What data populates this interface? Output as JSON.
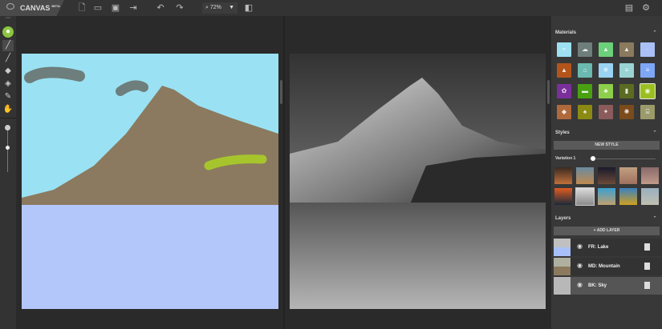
{
  "header": {
    "app_name": "CANVAS",
    "badge": "BETA",
    "logo_text": "NVIDIA",
    "zoom": "72%"
  },
  "materials": {
    "title": "Materials",
    "swatches": [
      {
        "color": "#9ee0f2",
        "icon": "≈"
      },
      {
        "color": "#6e7e7b",
        "icon": "☁"
      },
      {
        "color": "#6ccf7a",
        "icon": "▲"
      },
      {
        "color": "#8b7a5e",
        "icon": "▲"
      },
      {
        "color": "#a9c1f7",
        "icon": "·"
      },
      {
        "color": "#b3551b",
        "icon": "▲"
      },
      {
        "color": "#6bb9b1",
        "icon": "⌂"
      },
      {
        "color": "#99d2f2",
        "icon": "❄"
      },
      {
        "color": "#9ad3d3",
        "icon": "≡"
      },
      {
        "color": "#7ea6f7",
        "icon": "≡"
      },
      {
        "color": "#7b2f9b",
        "icon": "✿"
      },
      {
        "color": "#49a111",
        "icon": "▬"
      },
      {
        "color": "#8dcf4b",
        "icon": "♣"
      },
      {
        "color": "#5b6b21",
        "icon": "▮"
      },
      {
        "color": "#9bbf22",
        "icon": "◉"
      },
      {
        "color": "#b0693a",
        "icon": "◆"
      },
      {
        "color": "#8b8a12",
        "icon": "♠"
      },
      {
        "color": "#8b5a5b",
        "icon": "✦"
      },
      {
        "color": "#7b4b1b",
        "icon": "✺"
      },
      {
        "color": "#9b9a6b",
        "icon": "⌸"
      }
    ],
    "selected_index": 14
  },
  "styles": {
    "title": "Styles",
    "new_style": "NEW STYLE",
    "variation_label": "Variation 1",
    "variation_value": 0.05,
    "thumbs": [
      [
        "#3a2a20",
        "#c0703a"
      ],
      [
        "#6a8aa0",
        "#c08a50"
      ],
      [
        "#1a1a2a",
        "#6a4a3a"
      ],
      [
        "#c0a080",
        "#a07060"
      ],
      [
        "#8a6a6a",
        "#c09a8a"
      ],
      [
        "#e05a20",
        "#1a2a3a"
      ],
      [
        "#dcdcdc",
        "#8a8a8a"
      ],
      [
        "#3aa0d0",
        "#c0a070"
      ],
      [
        "#3a80c0",
        "#d0a020"
      ],
      [
        "#9ab0c0",
        "#c0c0b0"
      ]
    ],
    "selected_index": 6
  },
  "layers": {
    "title": "Layers",
    "add": "+ ADD LAYER",
    "items": [
      {
        "name": "FR: Lake",
        "thumb": [
          "#c0c0c0",
          "#a8c0f8"
        ]
      },
      {
        "name": "MD: Mountain",
        "thumb": [
          "#b0b0a0",
          "#8b7a5e"
        ]
      },
      {
        "name": "BK: Sky",
        "thumb": [
          "#b8b8b8",
          "#b8b8b8"
        ]
      }
    ],
    "selected_index": 2
  }
}
